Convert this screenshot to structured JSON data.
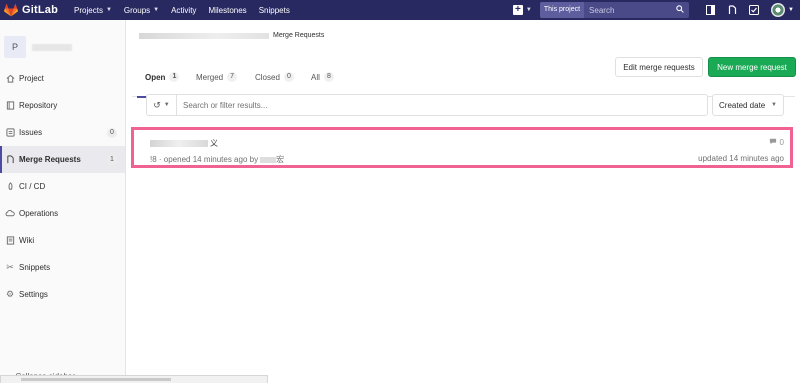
{
  "navbar": {
    "brand": "GitLab",
    "links": [
      {
        "label": "Projects",
        "dropdown": true
      },
      {
        "label": "Groups",
        "dropdown": true
      },
      {
        "label": "Activity",
        "dropdown": false
      },
      {
        "label": "Milestones",
        "dropdown": false
      },
      {
        "label": "Snippets",
        "dropdown": false
      }
    ],
    "search_scope": "This project",
    "search_placeholder": "Search",
    "icons": [
      "plus-icon",
      "search-icon",
      "sidebar-toggle-icon",
      "merge-request-icon",
      "todo-icon",
      "avatar"
    ]
  },
  "sidebar": {
    "project_avatar_letter": "P",
    "items": [
      {
        "label": "Project",
        "icon": "home-icon"
      },
      {
        "label": "Repository",
        "icon": "book-icon"
      },
      {
        "label": "Issues",
        "icon": "issues-icon",
        "badge": "0"
      },
      {
        "label": "Merge Requests",
        "icon": "merge-request-icon",
        "badge": "1",
        "active": true
      },
      {
        "label": "CI / CD",
        "icon": "rocket-icon"
      },
      {
        "label": "Operations",
        "icon": "cloud-gear-icon"
      },
      {
        "label": "Wiki",
        "icon": "wiki-icon"
      },
      {
        "label": "Snippets",
        "icon": "scissors-icon"
      },
      {
        "label": "Settings",
        "icon": "gear-icon"
      }
    ],
    "collapse_label": "Collapse sidebar"
  },
  "breadcrumb": {
    "current": "Merge Requests"
  },
  "tabs": [
    {
      "label": "Open",
      "count": "1",
      "active": true
    },
    {
      "label": "Merged",
      "count": "7"
    },
    {
      "label": "Closed",
      "count": "0"
    },
    {
      "label": "All",
      "count": "8"
    }
  ],
  "buttons": {
    "edit": "Edit merge requests",
    "new": "New merge request"
  },
  "filter": {
    "placeholder": "Search or filter results...",
    "sort_label": "Created date"
  },
  "merge_request": {
    "title_suffix": "义",
    "meta": "!8 · opened 14 minutes ago by",
    "author_suffix": "宏",
    "comments": "0",
    "updated": "updated 14 minutes ago"
  },
  "colors": {
    "navbar": "#292961",
    "accent": "#4b4ba3",
    "new_button": "#1aaa55",
    "highlight": "#f06292"
  }
}
